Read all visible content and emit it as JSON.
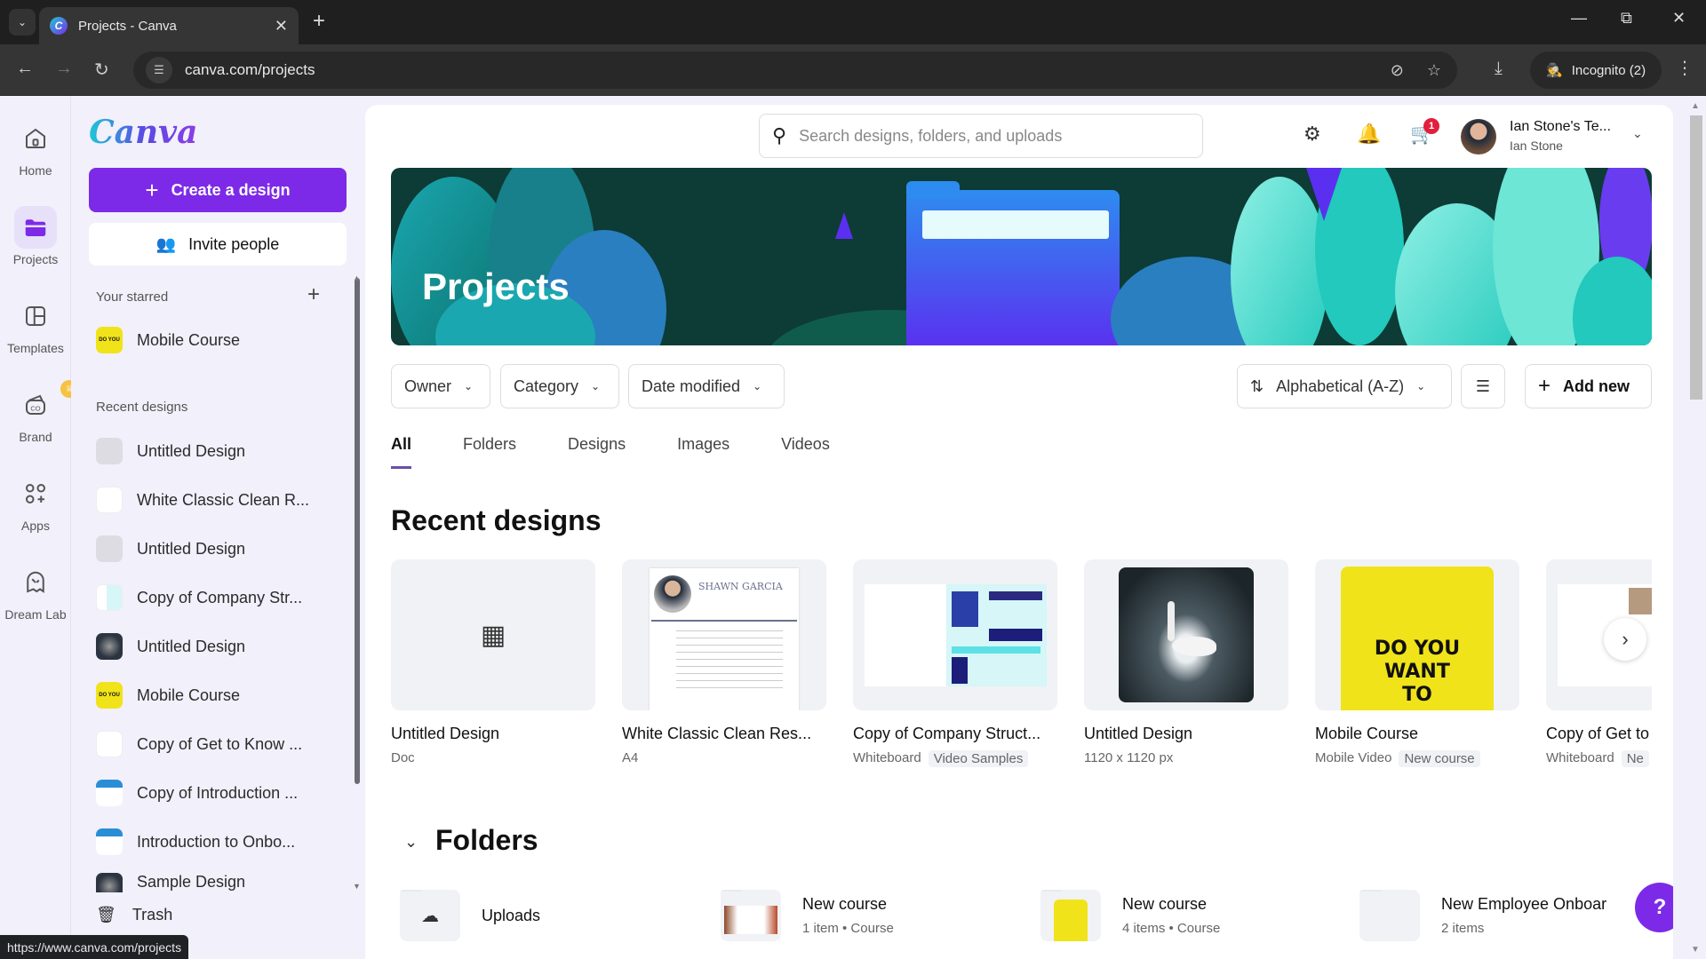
{
  "browser": {
    "tab_title": "Projects - Canva",
    "favicon_letter": "C",
    "url": "canva.com/projects",
    "incognito_label": "Incognito (2)",
    "status_url": "https://www.canva.com/projects"
  },
  "rail": {
    "items": [
      {
        "label": "Home",
        "icon": "home-icon"
      },
      {
        "label": "Projects",
        "icon": "folder-icon",
        "active": true
      },
      {
        "label": "Templates",
        "icon": "templates-icon"
      },
      {
        "label": "Brand",
        "icon": "brand-icon"
      },
      {
        "label": "Apps",
        "icon": "apps-icon"
      },
      {
        "label": "Dream Lab",
        "icon": "dream-lab-icon"
      }
    ]
  },
  "sidebar": {
    "logo": "Canva",
    "create_label": "Create a design",
    "invite_label": "Invite people",
    "starred_label": "Your starred",
    "starred": [
      {
        "label": "Mobile Course"
      }
    ],
    "recent_label": "Recent designs",
    "recent": [
      {
        "label": "Untitled Design"
      },
      {
        "label": "White Classic Clean R..."
      },
      {
        "label": "Untitled Design"
      },
      {
        "label": "Copy of Company Str..."
      },
      {
        "label": "Untitled Design"
      },
      {
        "label": "Mobile Course"
      },
      {
        "label": "Copy of Get to Know ..."
      },
      {
        "label": "Copy of Introduction ..."
      },
      {
        "label": "Introduction to Onbo..."
      },
      {
        "label": "Sample Design"
      }
    ],
    "trash_label": "Trash"
  },
  "header": {
    "search_placeholder": "Search designs, folders, and uploads",
    "cart_count": "1",
    "account_name": "Ian Stone's Te...",
    "account_sub": "Ian Stone"
  },
  "banner": {
    "title": "Projects"
  },
  "filters": {
    "owner": "Owner",
    "category": "Category",
    "date": "Date modified",
    "sort": "Alphabetical (A-Z)",
    "add_new": "Add new"
  },
  "tabs": [
    "All",
    "Folders",
    "Designs",
    "Images",
    "Videos"
  ],
  "recent_heading": "Recent designs",
  "designs": [
    {
      "name": "Untitled Design",
      "meta": "Doc",
      "tag": ""
    },
    {
      "name": "White Classic Clean Res...",
      "meta": "A4",
      "tag": "",
      "preview_heading": "SHAWN GARCIA"
    },
    {
      "name": "Copy of Company Struct...",
      "meta": "Whiteboard",
      "tag": "Video Samples"
    },
    {
      "name": "Untitled Design",
      "meta": "1120 x 1120 px",
      "tag": ""
    },
    {
      "name": "Mobile Course",
      "meta": "Mobile Video",
      "tag": "New course",
      "preview_text": "DO YOU WANT TO"
    },
    {
      "name": "Copy of Get to",
      "meta": "Whiteboard",
      "tag": "Ne"
    }
  ],
  "folders_heading": "Folders",
  "folders": [
    {
      "name": "Uploads",
      "meta": ""
    },
    {
      "name": "New course",
      "meta": "1 item • Course"
    },
    {
      "name": "New course",
      "meta": "4 items • Course"
    },
    {
      "name": "New Employee Onboar",
      "meta": "2 items"
    }
  ],
  "help_label": "?",
  "colors": {
    "brand": "#7d2ae8",
    "badge": "#e0203c"
  }
}
